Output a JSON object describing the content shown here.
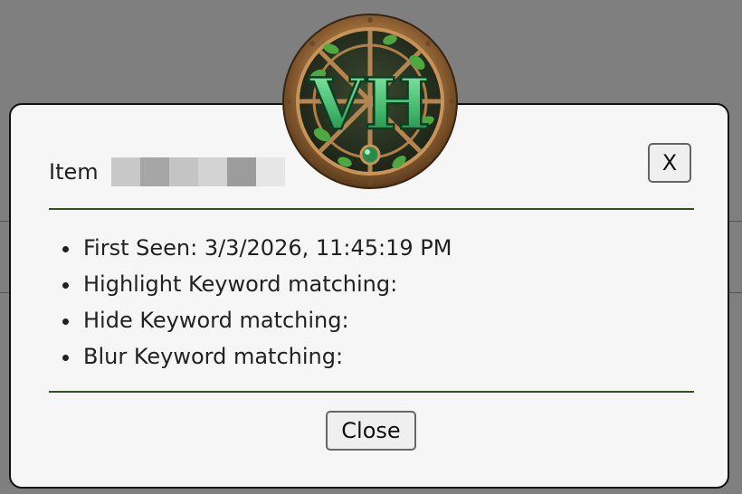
{
  "modal": {
    "item_label": "Item",
    "item_id_redacted_shades": [
      "#c8c8c8",
      "#a6a6a6",
      "#c4c4c4",
      "#d2d2d2",
      "#9c9c9c",
      "#e6e6e6"
    ],
    "close_x_label": "X",
    "info": [
      "First Seen: 3/3/2026, 11:45:19 PM",
      "Highlight Keyword matching:",
      "Hide Keyword matching:",
      "Blur Keyword matching:"
    ],
    "close_button_label": "Close"
  },
  "logo": {
    "text": "VH"
  },
  "colors": {
    "overlay": "#7f7f7f",
    "modal_bg": "#f6f6f6",
    "divider": "#2f5420",
    "logo_green": "#4fbf7a",
    "logo_bronze": "#a97844"
  }
}
